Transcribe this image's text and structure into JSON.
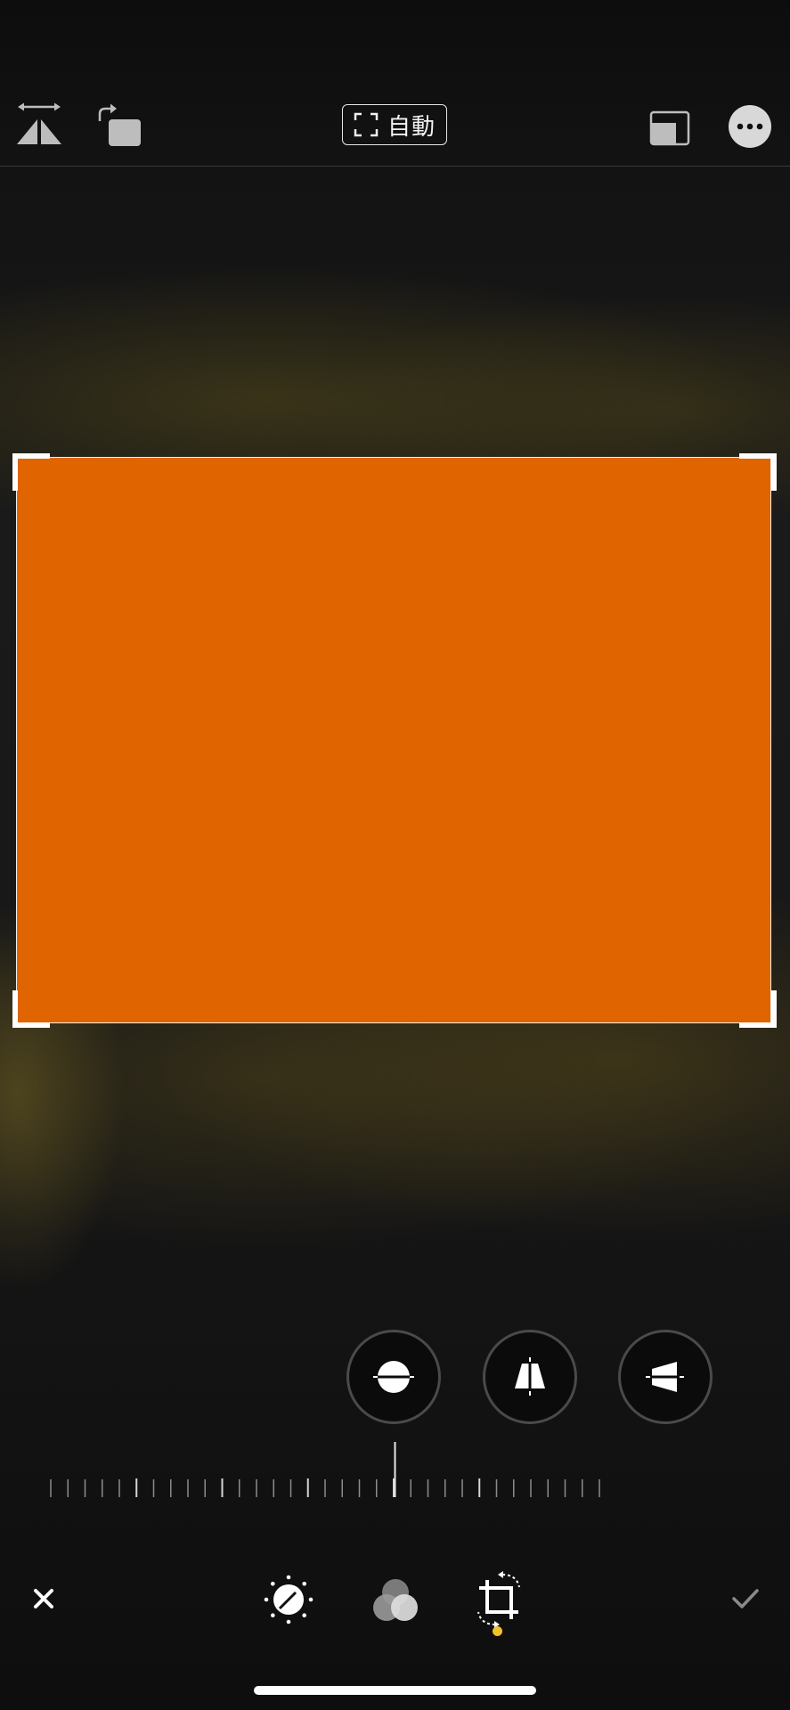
{
  "toolbar": {
    "auto_label": "自動",
    "icons": {
      "flip": "flip-horizontal-icon",
      "rotate": "rotate-icon",
      "auto": "auto-straighten-icon",
      "aspect": "aspect-ratio-icon",
      "more": "more-icon"
    }
  },
  "canvas": {
    "photo_color": "#e06400"
  },
  "modes": [
    {
      "name": "straighten",
      "icon": "straighten-icon"
    },
    {
      "name": "vertical",
      "icon": "vertical-perspective-icon"
    },
    {
      "name": "horizontal",
      "icon": "horizontal-perspective-icon"
    }
  ],
  "dial": {
    "value": 0
  },
  "bottombar": {
    "icons": {
      "cancel": "close-icon",
      "adjust": "adjust-icon",
      "filters": "filters-icon",
      "crop": "crop-rotate-icon",
      "done": "checkmark-icon"
    },
    "active_tab": "crop",
    "indicator_color": "#f3c12a"
  }
}
